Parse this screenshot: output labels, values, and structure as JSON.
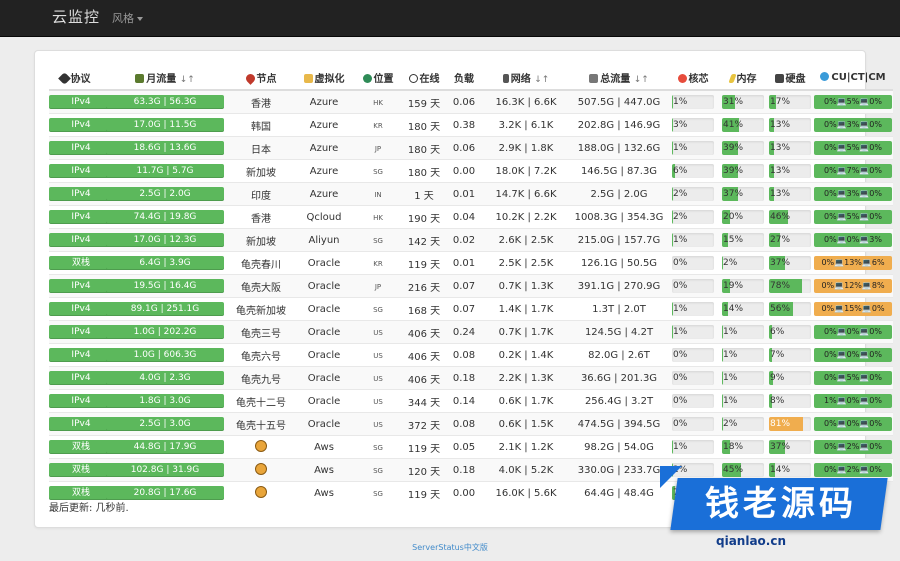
{
  "navbar": {
    "brand": "云监控",
    "style_menu": "风格"
  },
  "table": {
    "headers": {
      "protocol": "协议",
      "month_traffic": "月流量",
      "node": "节点",
      "virtualization": "虚拟化",
      "location": "位置",
      "online": "在线",
      "load": "负载",
      "network": "网络",
      "total_traffic": "总流量",
      "cores": "核芯",
      "memory": "内存",
      "disk": "硬盘",
      "cm": "CU|CT|CM"
    },
    "sort_indicator": "↓↑",
    "rows": [
      {
        "protocol": "IPv4",
        "month": "63.3G | 56.3G",
        "node": "香港",
        "virt": "Azure",
        "loc": "HK",
        "online": "159 天",
        "load": "0.06",
        "net": "16.3K | 6.6K",
        "total": "507.5G | 447.0G",
        "cpu": "1%",
        "cpu_v": 1,
        "mem": "31%",
        "mem_v": 31,
        "disk": "17%",
        "disk_v": 17,
        "cm": "0%💻5%💻0%",
        "cm_warn": false,
        "lion": false
      },
      {
        "protocol": "IPv4",
        "month": "17.0G | 11.5G",
        "node": "韩国",
        "virt": "Azure",
        "loc": "KR",
        "online": "180 天",
        "load": "0.38",
        "net": "3.2K | 6.1K",
        "total": "202.8G | 146.9G",
        "cpu": "3%",
        "cpu_v": 3,
        "mem": "41%",
        "mem_v": 41,
        "disk": "13%",
        "disk_v": 13,
        "cm": "0%💻3%💻0%",
        "cm_warn": false,
        "lion": false
      },
      {
        "protocol": "IPv4",
        "month": "18.6G | 13.6G",
        "node": "日本",
        "virt": "Azure",
        "loc": "JP",
        "online": "180 天",
        "load": "0.06",
        "net": "2.9K | 1.8K",
        "total": "188.0G | 132.6G",
        "cpu": "1%",
        "cpu_v": 1,
        "mem": "39%",
        "mem_v": 39,
        "disk": "13%",
        "disk_v": 13,
        "cm": "0%💻5%💻0%",
        "cm_warn": false,
        "lion": false
      },
      {
        "protocol": "IPv4",
        "month": "11.7G | 5.7G",
        "node": "新加坡",
        "virt": "Azure",
        "loc": "SG",
        "online": "180 天",
        "load": "0.00",
        "net": "18.0K | 7.2K",
        "total": "146.5G | 87.3G",
        "cpu": "6%",
        "cpu_v": 6,
        "mem": "39%",
        "mem_v": 39,
        "disk": "13%",
        "disk_v": 13,
        "cm": "0%💻7%💻0%",
        "cm_warn": false,
        "lion": false
      },
      {
        "protocol": "IPv4",
        "month": "2.5G | 2.0G",
        "node": "印度",
        "virt": "Azure",
        "loc": "IN",
        "online": "1 天",
        "load": "0.01",
        "net": "14.7K | 6.6K",
        "total": "2.5G | 2.0G",
        "cpu": "2%",
        "cpu_v": 2,
        "mem": "37%",
        "mem_v": 37,
        "disk": "13%",
        "disk_v": 13,
        "cm": "0%💻3%💻0%",
        "cm_warn": false,
        "lion": false
      },
      {
        "protocol": "IPv4",
        "month": "74.4G | 19.8G",
        "node": "香港",
        "virt": "Qcloud",
        "loc": "HK",
        "online": "190 天",
        "load": "0.04",
        "net": "10.2K | 2.2K",
        "total": "1008.3G | 354.3G",
        "cpu": "2%",
        "cpu_v": 2,
        "mem": "20%",
        "mem_v": 20,
        "disk": "46%",
        "disk_v": 46,
        "cm": "0%💻5%💻0%",
        "cm_warn": false,
        "lion": false
      },
      {
        "protocol": "IPv4",
        "month": "17.0G | 12.3G",
        "node": "新加坡",
        "virt": "Aliyun",
        "loc": "SG",
        "online": "142 天",
        "load": "0.02",
        "net": "2.6K | 2.5K",
        "total": "215.0G | 157.7G",
        "cpu": "1%",
        "cpu_v": 1,
        "mem": "15%",
        "mem_v": 15,
        "disk": "27%",
        "disk_v": 27,
        "cm": "0%💻0%💻3%",
        "cm_warn": false,
        "lion": false
      },
      {
        "protocol": "双栈",
        "month": "6.4G | 3.9G",
        "node": "龟壳春川",
        "virt": "Oracle",
        "loc": "KR",
        "online": "119 天",
        "load": "0.01",
        "net": "2.5K | 2.5K",
        "total": "126.1G | 50.5G",
        "cpu": "0%",
        "cpu_v": 0,
        "mem": "2%",
        "mem_v": 2,
        "disk": "37%",
        "disk_v": 37,
        "cm": "0%💻13%💻6%",
        "cm_warn": true,
        "lion": false
      },
      {
        "protocol": "IPv4",
        "month": "19.5G | 16.4G",
        "node": "龟壳大阪",
        "virt": "Oracle",
        "loc": "JP",
        "online": "216 天",
        "load": "0.07",
        "net": "0.7K | 1.3K",
        "total": "391.1G | 270.9G",
        "cpu": "0%",
        "cpu_v": 0,
        "mem": "19%",
        "mem_v": 19,
        "disk": "78%",
        "disk_v": 78,
        "cm": "0%💻12%💻8%",
        "cm_warn": true,
        "lion": false
      },
      {
        "protocol": "IPv4",
        "month": "89.1G | 251.1G",
        "node": "龟壳新加坡",
        "virt": "Oracle",
        "loc": "SG",
        "online": "168 天",
        "load": "0.07",
        "net": "1.4K | 1.7K",
        "total": "1.3T | 2.0T",
        "cpu": "1%",
        "cpu_v": 1,
        "mem": "14%",
        "mem_v": 14,
        "disk": "56%",
        "disk_v": 56,
        "cm": "0%💻15%💻0%",
        "cm_warn": true,
        "lion": false
      },
      {
        "protocol": "IPv4",
        "month": "1.0G | 202.2G",
        "node": "龟壳三号",
        "virt": "Oracle",
        "loc": "US",
        "online": "406 天",
        "load": "0.24",
        "net": "0.7K | 1.7K",
        "total": "124.5G | 4.2T",
        "cpu": "1%",
        "cpu_v": 1,
        "mem": "1%",
        "mem_v": 1,
        "disk": "6%",
        "disk_v": 6,
        "cm": "0%💻0%💻0%",
        "cm_warn": false,
        "lion": false
      },
      {
        "protocol": "IPv4",
        "month": "1.0G | 606.3G",
        "node": "龟壳六号",
        "virt": "Oracle",
        "loc": "US",
        "online": "406 天",
        "load": "0.08",
        "net": "0.2K | 1.4K",
        "total": "82.0G | 2.6T",
        "cpu": "0%",
        "cpu_v": 0,
        "mem": "1%",
        "mem_v": 1,
        "disk": "7%",
        "disk_v": 7,
        "cm": "0%💻0%💻0%",
        "cm_warn": false,
        "lion": false
      },
      {
        "protocol": "IPv4",
        "month": "4.0G | 2.3G",
        "node": "龟壳九号",
        "virt": "Oracle",
        "loc": "US",
        "online": "406 天",
        "load": "0.18",
        "net": "2.2K | 1.3K",
        "total": "36.6G | 201.3G",
        "cpu": "0%",
        "cpu_v": 0,
        "mem": "1%",
        "mem_v": 1,
        "disk": "9%",
        "disk_v": 9,
        "cm": "0%💻5%💻0%",
        "cm_warn": false,
        "lion": false
      },
      {
        "protocol": "IPv4",
        "month": "1.8G | 3.0G",
        "node": "龟壳十二号",
        "virt": "Oracle",
        "loc": "US",
        "online": "344 天",
        "load": "0.14",
        "net": "0.6K | 1.7K",
        "total": "256.4G | 3.2T",
        "cpu": "0%",
        "cpu_v": 0,
        "mem": "1%",
        "mem_v": 1,
        "disk": "8%",
        "disk_v": 8,
        "cm": "1%💻0%💻0%",
        "cm_warn": false,
        "lion": false
      },
      {
        "protocol": "IPv4",
        "month": "2.5G | 3.0G",
        "node": "龟壳十五号",
        "virt": "Oracle",
        "loc": "US",
        "online": "372 天",
        "load": "0.08",
        "net": "0.6K | 1.5K",
        "total": "474.5G | 394.5G",
        "cpu": "0%",
        "cpu_v": 0,
        "mem": "2%",
        "mem_v": 2,
        "disk": "81%",
        "disk_v": 81,
        "disk_warn": true,
        "cm": "0%💻0%💻0%",
        "cm_warn": false,
        "lion": false
      },
      {
        "protocol": "双栈",
        "month": "44.8G | 17.9G",
        "node": "",
        "virt": "Aws",
        "loc": "SG",
        "online": "119 天",
        "load": "0.05",
        "net": "2.1K | 1.2K",
        "total": "98.2G | 54.0G",
        "cpu": "1%",
        "cpu_v": 1,
        "mem": "18%",
        "mem_v": 18,
        "disk": "37%",
        "disk_v": 37,
        "cm": "0%💻2%💻0%",
        "cm_warn": false,
        "lion": true
      },
      {
        "protocol": "双栈",
        "month": "102.8G | 31.9G",
        "node": "",
        "virt": "Aws",
        "loc": "SG",
        "online": "120 天",
        "load": "0.18",
        "net": "4.0K | 5.2K",
        "total": "330.0G | 233.7G",
        "cpu": "2%",
        "cpu_v": 2,
        "mem": "45%",
        "mem_v": 45,
        "disk": "14%",
        "disk_v": 14,
        "cm": "0%💻2%💻0%",
        "cm_warn": false,
        "lion": true
      },
      {
        "protocol": "双栈",
        "month": "20.8G | 17.6G",
        "node": "",
        "virt": "Aws",
        "loc": "SG",
        "online": "119 天",
        "load": "0.00",
        "net": "16.0K | 5.6K",
        "total": "64.4G | 48.4G",
        "cpu": "7%",
        "cpu_v": 7,
        "mem": "34%",
        "mem_v": 34,
        "disk": "",
        "disk_v": 0,
        "cm": "",
        "cm_warn": false,
        "lion": true
      }
    ]
  },
  "last_updated": "最后更新: 几秒前.",
  "footer": "ServerStatus中文版",
  "watermark": {
    "text": "钱老源码",
    "url": "qianlao.cn"
  },
  "colors": {
    "ok": "#5cb85c",
    "warn": "#f0ad4e",
    "navbar": "#222222",
    "link": "#428bca"
  }
}
